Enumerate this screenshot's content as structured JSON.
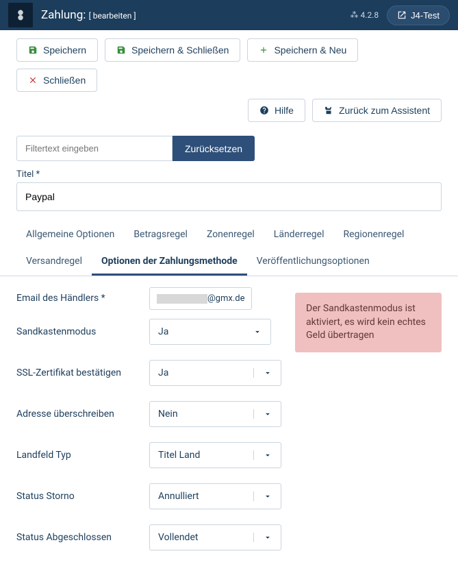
{
  "topbar": {
    "title": "Zahlung:",
    "subtitle": "[ bearbeiten ]",
    "version": "4.2.8",
    "version_prefix": "⁂",
    "env_btn": "J4-Test"
  },
  "toolbar": {
    "save": "Speichern",
    "save_close": "Speichern & Schließen",
    "save_new": "Speichern & Neu",
    "close": "Schließen",
    "help": "Hilfe",
    "back": "Zurück zum Assistent"
  },
  "filter": {
    "placeholder": "Filtertext eingeben",
    "reset": "Zurücksetzen"
  },
  "title_field": {
    "label": "Titel *",
    "value": "Paypal"
  },
  "tabs": [
    {
      "label": "Allgemeine Optionen",
      "active": false
    },
    {
      "label": "Betragsregel",
      "active": false
    },
    {
      "label": "Zonenregel",
      "active": false
    },
    {
      "label": "Länderregel",
      "active": false
    },
    {
      "label": "Regionenregel",
      "active": false
    },
    {
      "label": "Versandregel",
      "active": false
    },
    {
      "label": "Optionen der Zahlungsmethode",
      "active": true
    },
    {
      "label": "Veröffentlichungsoptionen",
      "active": false
    }
  ],
  "form": {
    "email_label": "Email des Händlers *",
    "email_suffix": "@gmx.de",
    "sandbox_label": "Sandkastenmodus",
    "sandbox_value": "Ja",
    "ssl_label": "SSL-Zertifikat bestätigen",
    "ssl_value": "Ja",
    "address_label": "Adresse überschreiben",
    "address_value": "Nein",
    "landfield_label": "Landfeld Typ",
    "landfield_value": "Titel Land",
    "storno_label": "Status Storno",
    "storno_value": "Annulliert",
    "completed_label": "Status Abgeschlossen",
    "completed_value": "Vollendet"
  },
  "alert": "Der Sandkastenmodus ist aktiviert, es wird kein echtes Geld übertragen"
}
